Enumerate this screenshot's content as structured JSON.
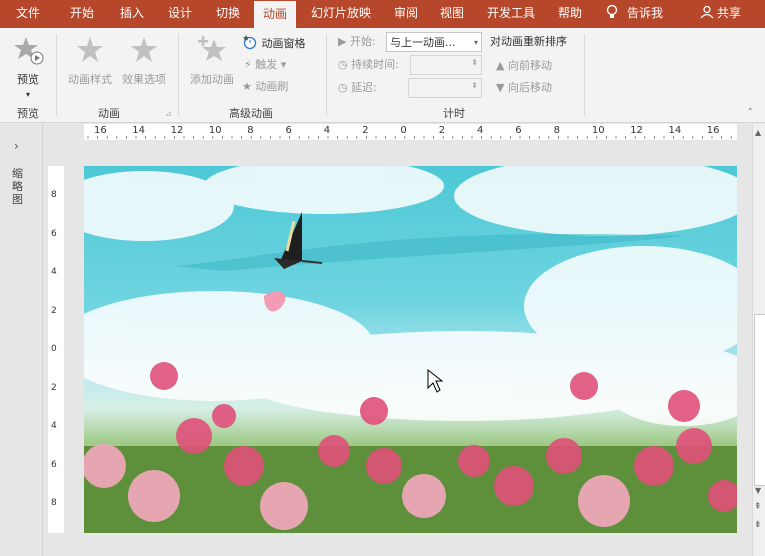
{
  "tabs": [
    {
      "label": "文件",
      "active": false
    },
    {
      "label": "开始",
      "active": false
    },
    {
      "label": "插入",
      "active": false
    },
    {
      "label": "设计",
      "active": false
    },
    {
      "label": "切换",
      "active": false
    },
    {
      "label": "动画",
      "active": true
    },
    {
      "label": "幻灯片放映",
      "active": false
    },
    {
      "label": "审阅",
      "active": false
    },
    {
      "label": "视图",
      "active": false
    },
    {
      "label": "开发工具",
      "active": false
    },
    {
      "label": "帮助",
      "active": false
    }
  ],
  "tell_me": "告诉我",
  "share": "共享",
  "ribbon": {
    "preview": {
      "button": "预览",
      "group": "预览"
    },
    "animation": {
      "styles": "动画样式",
      "effects": "效果选项",
      "group": "动画"
    },
    "advanced": {
      "add": "添加动画",
      "pane": "动画窗格",
      "trigger": "触发",
      "painter": "动画刷",
      "group": "高级动画"
    },
    "timing": {
      "start_label": "开始:",
      "start_value": "与上一动画...",
      "duration_label": "持续时间:",
      "delay_label": "延迟:",
      "reorder": "对动画重新排序",
      "move_earlier": "向前移动",
      "move_later": "向后移动",
      "group": "计时"
    }
  },
  "ruler": {
    "labels": [
      "16",
      "14",
      "12",
      "10",
      "8",
      "6",
      "4",
      "2",
      "0",
      "2",
      "4",
      "6",
      "8",
      "10",
      "12",
      "14",
      "16"
    ]
  },
  "vruler": {
    "labels": [
      "8",
      "6",
      "4",
      "2",
      "0",
      "2",
      "4",
      "6",
      "8"
    ]
  },
  "sidebar": {
    "label": "缩略图"
  },
  "colors": {
    "tabbar": "#b7472a",
    "ribbon": "#f3f3f3",
    "sky": "#4ec8d6"
  }
}
